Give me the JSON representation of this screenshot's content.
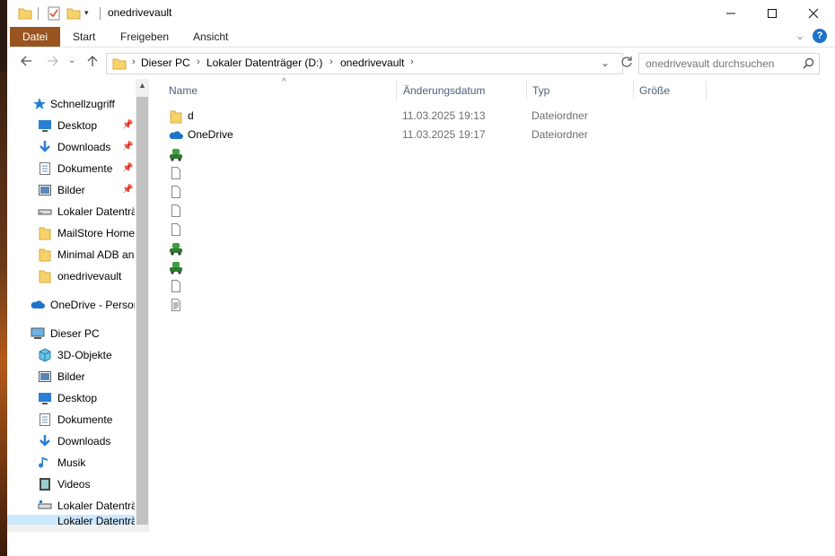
{
  "window": {
    "title": "onedrivevault"
  },
  "ribbon": {
    "tabs": [
      "Datei",
      "Start",
      "Freigeben",
      "Ansicht"
    ]
  },
  "address": {
    "crumbs": [
      "Dieser PC",
      "Lokaler Datenträger (D:)",
      "onedrivevault"
    ]
  },
  "search": {
    "placeholder": "onedrivevault durchsuchen"
  },
  "sidebar": {
    "quick_access": "Schnellzugriff",
    "quick_items": [
      {
        "label": "Desktop",
        "icon": "desktop-icon",
        "pinned": true
      },
      {
        "label": "Downloads",
        "icon": "downloads-icon",
        "pinned": true
      },
      {
        "label": "Dokumente",
        "icon": "documents-icon",
        "pinned": true
      },
      {
        "label": "Bilder",
        "icon": "pictures-icon",
        "pinned": true
      },
      {
        "label": "Lokaler Datenträ",
        "icon": "drive-icon",
        "pinned": false
      },
      {
        "label": "MailStore Home",
        "icon": "folder-icon",
        "pinned": false
      },
      {
        "label": "Minimal ADB an",
        "icon": "folder-icon",
        "pinned": false
      },
      {
        "label": "onedrivevault",
        "icon": "folder-icon",
        "pinned": false
      }
    ],
    "onedrive": "OneDrive - Persor",
    "this_pc": "Dieser PC",
    "pc_items": [
      {
        "label": "3D-Objekte",
        "icon": "3d-objects-icon"
      },
      {
        "label": "Bilder",
        "icon": "pictures-icon"
      },
      {
        "label": "Desktop",
        "icon": "desktop-icon"
      },
      {
        "label": "Dokumente",
        "icon": "documents-icon"
      },
      {
        "label": "Downloads",
        "icon": "downloads-icon"
      },
      {
        "label": "Musik",
        "icon": "music-icon"
      },
      {
        "label": "Videos",
        "icon": "videos-icon"
      },
      {
        "label": "Lokaler Datenträ",
        "icon": "drive-icon"
      },
      {
        "label": "Lokaler Datenträ",
        "icon": "drive-icon"
      }
    ]
  },
  "columns": {
    "name": "Name",
    "date": "Änderungsdatum",
    "type": "Typ",
    "size": "Größe"
  },
  "files": [
    {
      "name": "d",
      "date": "11.03.2025 19:13",
      "type": "Dateiordner",
      "icon": "folder-icon"
    },
    {
      "name": "OneDrive",
      "date": "11.03.2025 19:17",
      "type": "Dateiordner",
      "icon": "onedrive-cloud-icon"
    },
    {
      "name": "",
      "date": "",
      "type": "",
      "icon": "executable-icon"
    },
    {
      "name": "",
      "date": "",
      "type": "",
      "icon": "file-icon"
    },
    {
      "name": "",
      "date": "",
      "type": "",
      "icon": "file-icon"
    },
    {
      "name": "",
      "date": "",
      "type": "",
      "icon": "file-icon"
    },
    {
      "name": "",
      "date": "",
      "type": "",
      "icon": "file-icon"
    },
    {
      "name": "",
      "date": "",
      "type": "",
      "icon": "executable-icon"
    },
    {
      "name": "",
      "date": "",
      "type": "",
      "icon": "executable-icon"
    },
    {
      "name": "",
      "date": "",
      "type": "",
      "icon": "file-icon"
    },
    {
      "name": "",
      "date": "",
      "type": "",
      "icon": "text-file-icon"
    }
  ],
  "colors": {
    "file_tab": "#99541f",
    "header_text": "#4c607a",
    "folder_yellow": "#f7d26a",
    "accent_blue": "#1e73c9"
  }
}
